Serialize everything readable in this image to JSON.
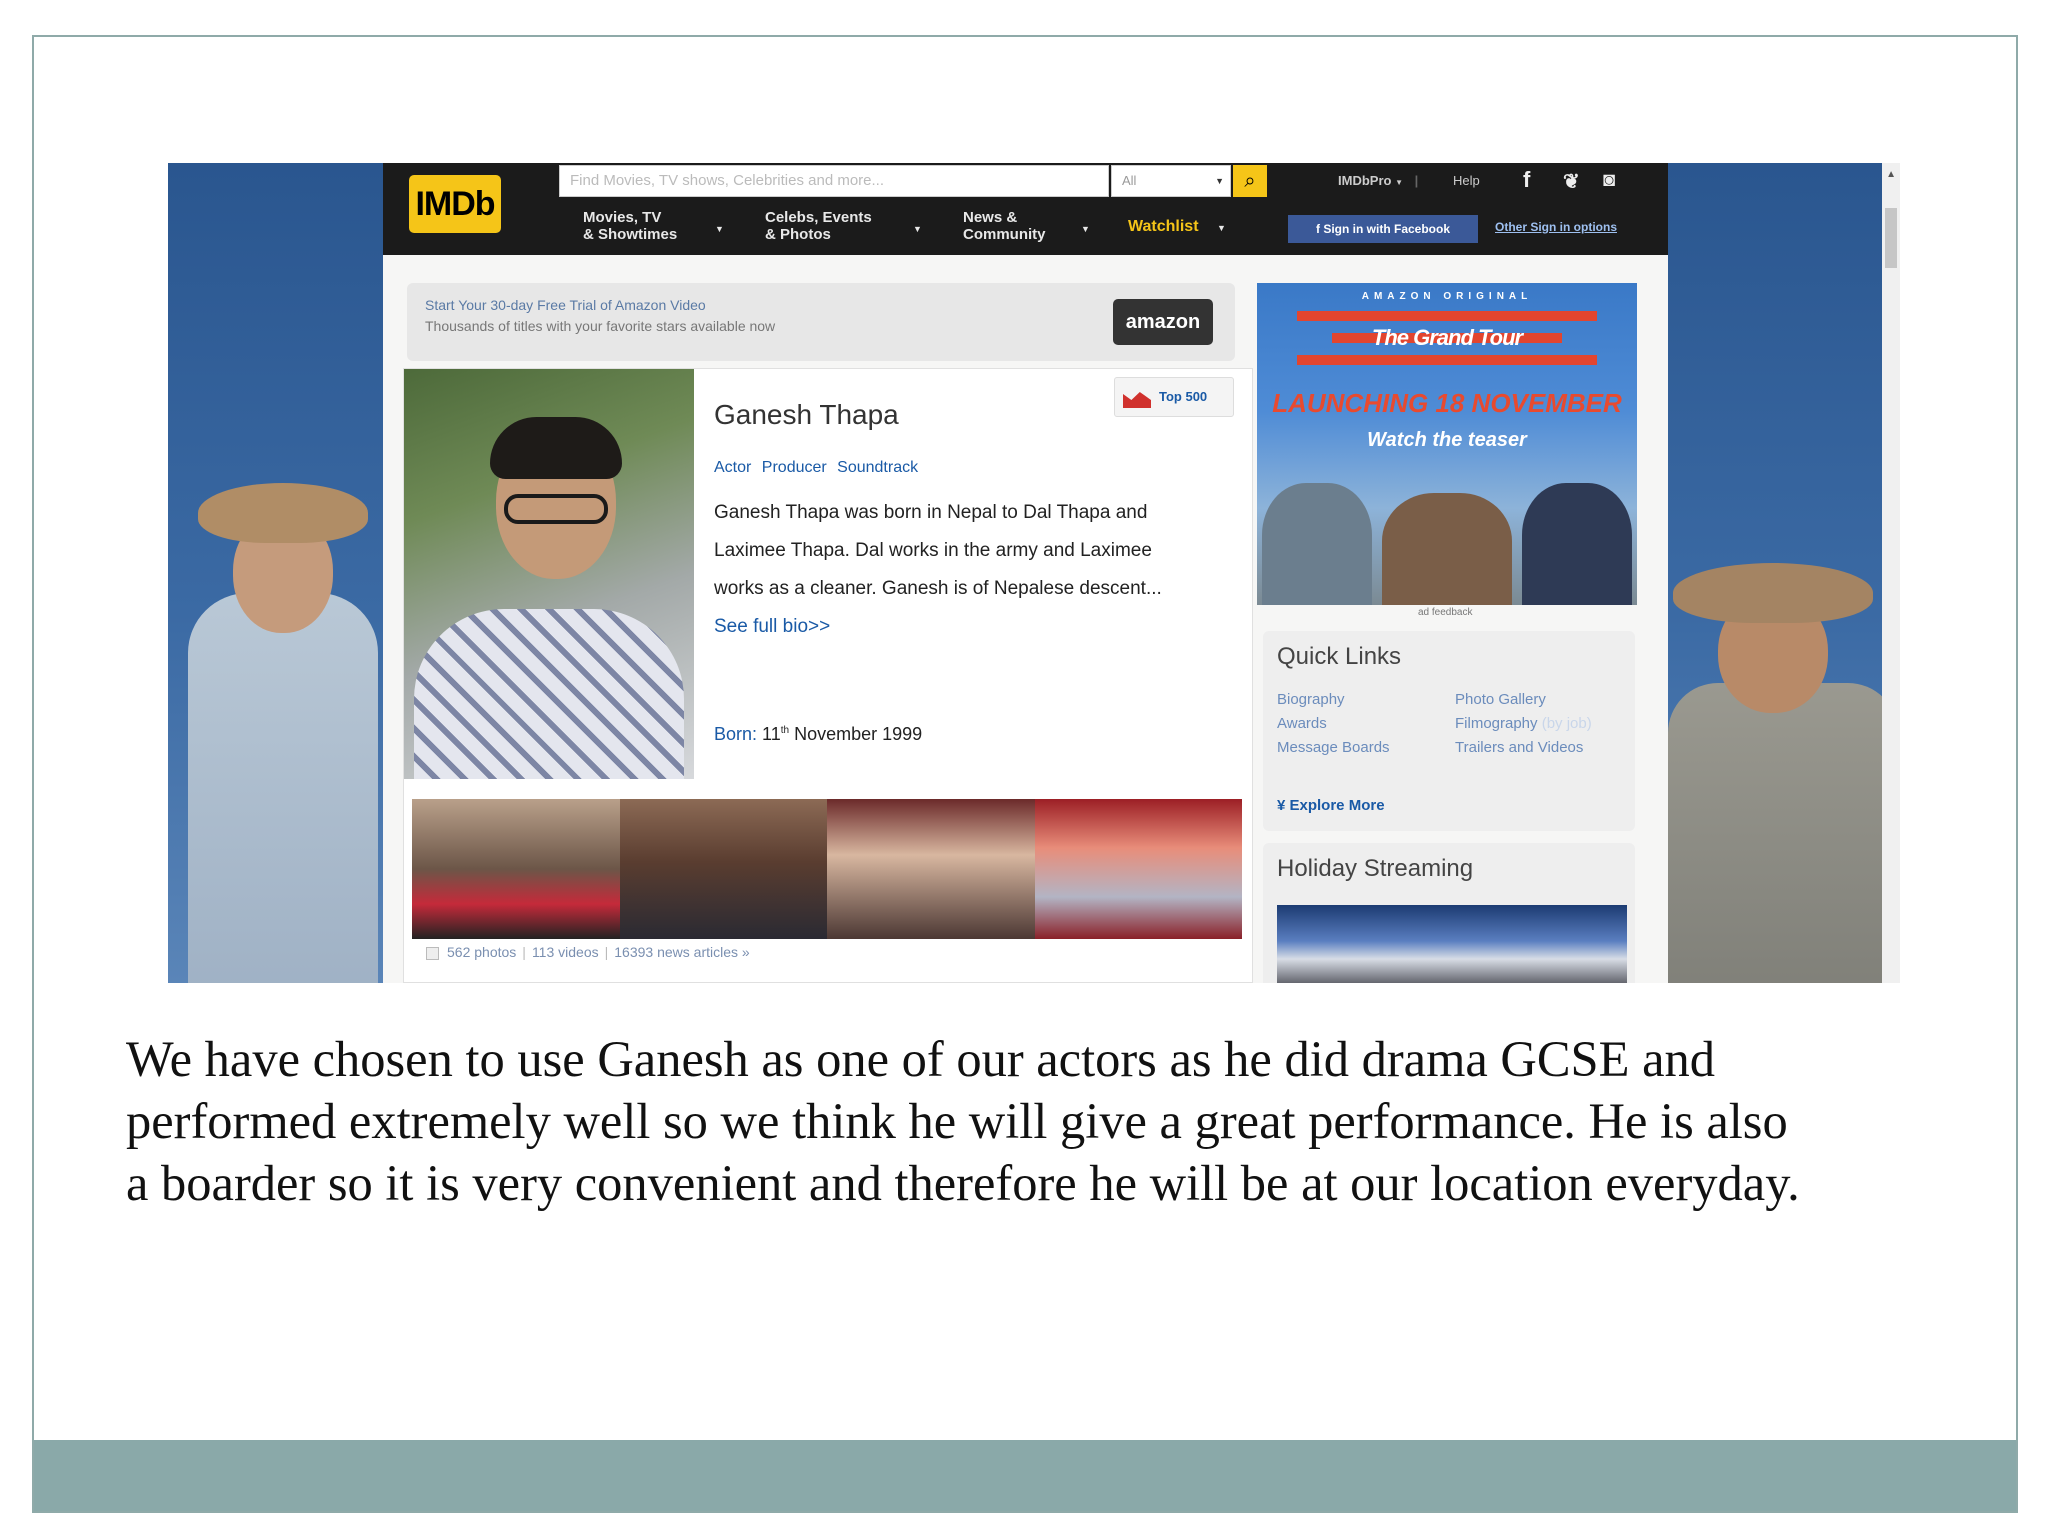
{
  "imdb": {
    "logo": "IMDb",
    "search_placeholder": "Find Movies, TV shows, Celebrities and more...",
    "search_category": "All",
    "pro_label": "IMDbPro",
    "help_label": "Help",
    "nav": {
      "movies_line1": "Movies, TV",
      "movies_line2": "& Showtimes",
      "celebs_line1": "Celebs, Events",
      "celebs_line2": "& Photos",
      "news_line1": "News &",
      "news_line2": "Community",
      "watchlist": "Watchlist"
    },
    "facebook_button": "Sign in with Facebook",
    "other_sign_in": "Other Sign in options",
    "promo": {
      "line1": "Start Your 30-day Free Trial of Amazon Video",
      "line2": "Thousands of titles with your favorite stars available now",
      "button": "amazon"
    },
    "profile": {
      "name": "Ganesh Thapa",
      "top500": "Top 500",
      "roles": "Actor Producer Soundtrack",
      "bio": "Ganesh Thapa was born in Nepal to Dal Thapa and Laximee Thapa. Dal works in the army and Laximee works as a cleaner. Ganesh is of Nepalese descent...",
      "bio_link": "See full bio>>",
      "born_label": "Born:",
      "born_day": "11",
      "born_suffix": "th",
      "born_rest": "November 1999"
    },
    "media": {
      "photos": "562 photos",
      "videos": "113 videos",
      "news": "16393 news articles »"
    },
    "ad": {
      "original": "AMAZON ORIGINAL",
      "title": "The Grand Tour",
      "launch": "LAUNCHING 18 NOVEMBER",
      "teaser": "Watch the teaser",
      "feedback": "ad feedback"
    },
    "quick_links": {
      "title": "Quick Links",
      "biography": "Biography",
      "awards": "Awards",
      "message_boards": "Message Boards",
      "photo_gallery": "Photo Gallery",
      "filmography": "Filmography",
      "filmography_sub": "(by job)",
      "trailers": "Trailers and Videos",
      "explore_more": "¥ Explore More"
    },
    "holiday": {
      "title": "Holiday Streaming"
    }
  },
  "caption": {
    "line1": "We have chosen to use Ganesh as one of our actors as he did drama GCSE and",
    "line2": "performed extremely well so we think he will give a great performance. He is also",
    "line3": "a boarder so it is very convenient and therefore he will be at our location everyday."
  },
  "colors": {
    "footer_bar": "#8aa9a9",
    "imdb_yellow": "#f5c518",
    "link_blue": "#1a5aa6"
  },
  "icons": [
    "search-icon",
    "facebook-icon",
    "twitter-icon",
    "instagram-icon",
    "chart-icon"
  ]
}
